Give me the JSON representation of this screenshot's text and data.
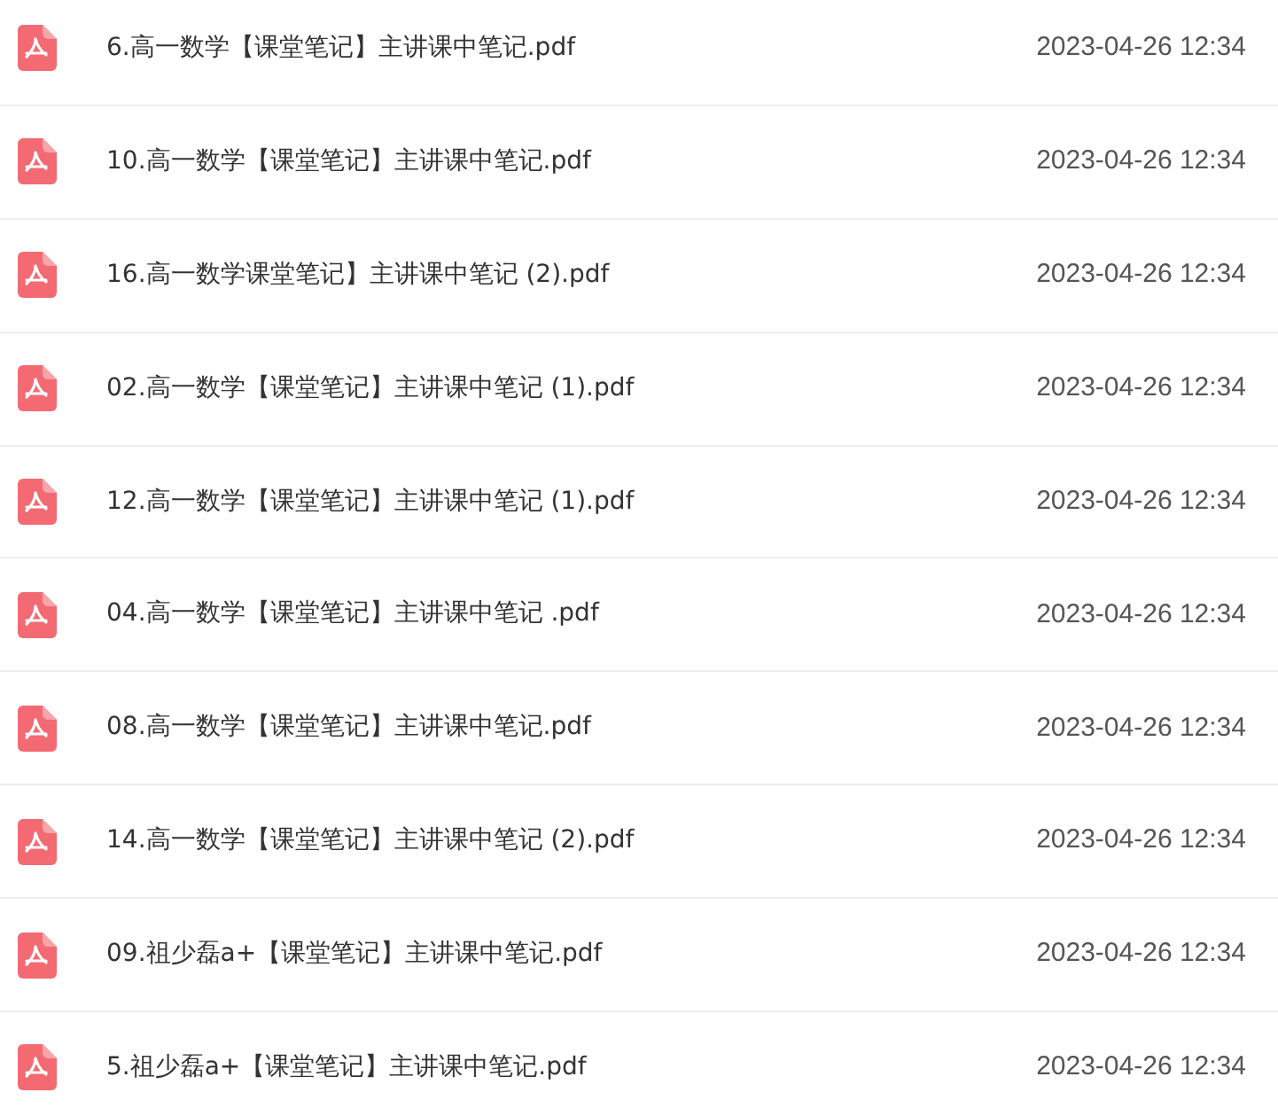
{
  "files": [
    {
      "name": "6.高一数学【课堂笔记】主讲课中笔记.pdf",
      "date": "2023-04-26 12:34"
    },
    {
      "name": "10.高一数学【课堂笔记】主讲课中笔记.pdf",
      "date": "2023-04-26 12:34"
    },
    {
      "name": "16.高一数学课堂笔记】主讲课中笔记 (2).pdf",
      "date": "2023-04-26 12:34"
    },
    {
      "name": "02.高一数学【课堂笔记】主讲课中笔记 (1).pdf",
      "date": "2023-04-26 12:34"
    },
    {
      "name": "12.高一数学【课堂笔记】主讲课中笔记 (1).pdf",
      "date": "2023-04-26 12:34"
    },
    {
      "name": "04.高一数学【课堂笔记】主讲课中笔记 .pdf",
      "date": "2023-04-26 12:34"
    },
    {
      "name": "08.高一数学【课堂笔记】主讲课中笔记.pdf",
      "date": "2023-04-26 12:34"
    },
    {
      "name": "14.高一数学【课堂笔记】主讲课中笔记 (2).pdf",
      "date": "2023-04-26 12:34"
    },
    {
      "name": "09.祖少磊a+【课堂笔记】主讲课中笔记.pdf",
      "date": "2023-04-26 12:34"
    },
    {
      "name": "5.祖少磊a+【课堂笔记】主讲课中笔记.pdf",
      "date": "2023-04-26 12:34"
    }
  ]
}
